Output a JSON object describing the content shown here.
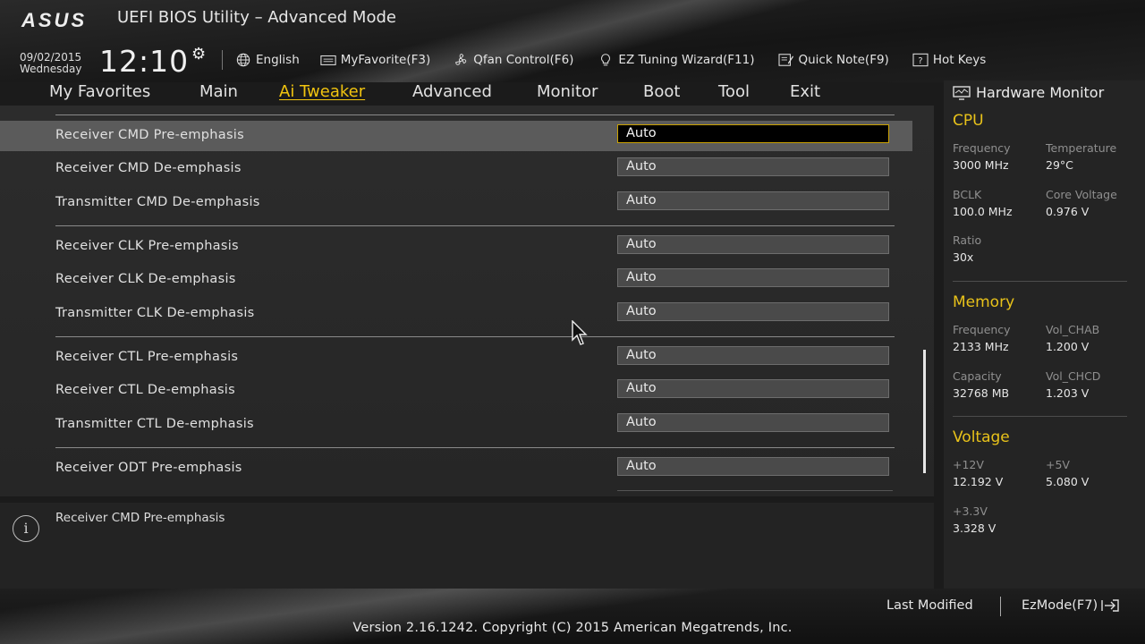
{
  "header": {
    "logo": "ASUS",
    "title": "UEFI BIOS Utility – Advanced Mode",
    "date": "09/02/2015",
    "weekday": "Wednesday",
    "time": "12:10"
  },
  "toolbar": {
    "language": "English",
    "myfavorite": "MyFavorite(F3)",
    "qfan": "Qfan Control(F6)",
    "ez_tuning": "EZ Tuning Wizard(F11)",
    "quick_note": "Quick Note(F9)",
    "hot_keys": "Hot Keys"
  },
  "nav": {
    "tabs": [
      "My Favorites",
      "Main",
      "Ai Tweaker",
      "Advanced",
      "Monitor",
      "Boot",
      "Tool",
      "Exit"
    ],
    "active": "Ai Tweaker"
  },
  "settings": [
    {
      "label": "Receiver CMD Pre-emphasis",
      "value": "Auto",
      "selected": true
    },
    {
      "label": "Receiver CMD De-emphasis",
      "value": "Auto"
    },
    {
      "label": "Transmitter CMD De-emphasis",
      "value": "Auto"
    },
    {
      "label": "Receiver CLK Pre-emphasis",
      "value": "Auto"
    },
    {
      "label": "Receiver CLK De-emphasis",
      "value": "Auto"
    },
    {
      "label": "Transmitter CLK De-emphasis",
      "value": "Auto"
    },
    {
      "label": "Receiver CTL Pre-emphasis",
      "value": "Auto"
    },
    {
      "label": "Receiver CTL De-emphasis",
      "value": "Auto"
    },
    {
      "label": "Transmitter CTL De-emphasis",
      "value": "Auto"
    },
    {
      "label": "Receiver ODT Pre-emphasis",
      "value": "Auto"
    }
  ],
  "help": {
    "text": "Receiver CMD Pre-emphasis"
  },
  "hardware_monitor": {
    "title": "Hardware Monitor",
    "cpu": {
      "heading": "CPU",
      "frequency_label": "Frequency",
      "frequency": "3000 MHz",
      "temperature_label": "Temperature",
      "temperature": "29°C",
      "bclk_label": "BCLK",
      "bclk": "100.0 MHz",
      "core_voltage_label": "Core Voltage",
      "core_voltage": "0.976 V",
      "ratio_label": "Ratio",
      "ratio": "30x"
    },
    "memory": {
      "heading": "Memory",
      "frequency_label": "Frequency",
      "frequency": "2133 MHz",
      "vol_chab_label": "Vol_CHAB",
      "vol_chab": "1.200 V",
      "capacity_label": "Capacity",
      "capacity": "32768 MB",
      "vol_chcd_label": "Vol_CHCD",
      "vol_chcd": "1.203 V"
    },
    "voltage": {
      "heading": "Voltage",
      "v12_label": "+12V",
      "v12": "12.192 V",
      "v5_label": "+5V",
      "v5": "5.080 V",
      "v33_label": "+3.3V",
      "v33": "3.328 V"
    }
  },
  "footer": {
    "last_modified": "Last Modified",
    "ezmode": "EzMode(F7)",
    "version": "Version 2.16.1242. Copyright (C) 2015 American Megatrends, Inc."
  },
  "colors": {
    "accent": "#f1c40f",
    "selected_row": "#5b5b5b",
    "selected_border": "#c9a100"
  }
}
